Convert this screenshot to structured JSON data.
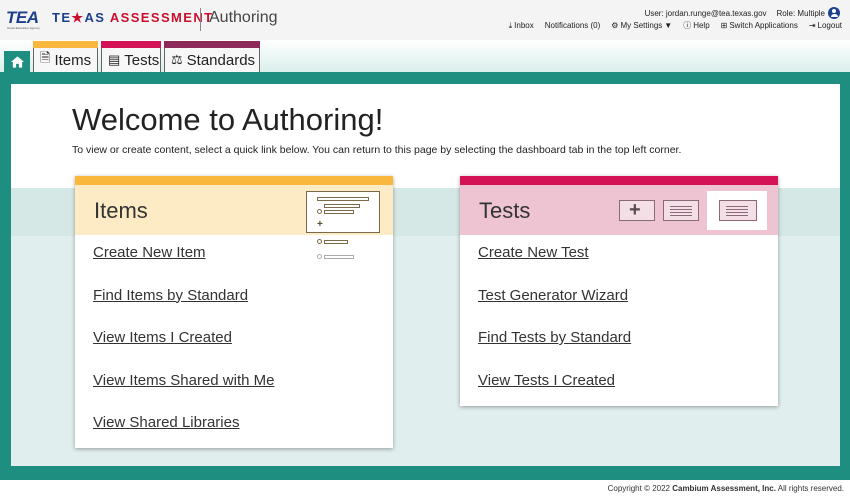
{
  "header": {
    "logo_tea": "TEA",
    "logo_tea_sub": "Texas Education Agency",
    "logo_texas_1": "TE",
    "logo_texas_2": "AS ",
    "logo_texas_3": "ASSESSMENT",
    "app_title": "Authoring",
    "user_label": "User: jordan.runge@tea.texas.gov",
    "role_label": "Role: Multiple",
    "nav": {
      "inbox": "Inbox",
      "notifications": "Notifications (0)",
      "settings": "My Settings",
      "help": "Help",
      "switch_apps": "Switch Applications",
      "logout": "Logout"
    }
  },
  "tabs": {
    "items": "Items",
    "tests": "Tests",
    "standards": "Standards"
  },
  "welcome": {
    "title": "Welcome to Authoring!",
    "subtitle": "To view or create content, select a quick link below. You can return to this page by selecting the dashboard tab in the top left corner."
  },
  "items_card": {
    "title": "Items",
    "links": [
      "Create New Item",
      "Find Items by Standard",
      "View Items I Created",
      "View Items Shared with Me",
      "View Shared Libraries"
    ]
  },
  "tests_card": {
    "title": "Tests",
    "links": [
      "Create New Test",
      "Test Generator Wizard",
      "Find Tests by Standard",
      "View Tests I Created"
    ]
  },
  "footer": {
    "copyright": "Copyright © 2022 ",
    "company": "Cambium Assessment, Inc.",
    "rights": " All rights reserved."
  },
  "colors": {
    "teal": "#1d8e80",
    "items_accent": "#f9b83d",
    "tests_accent": "#d41357",
    "standards_accent": "#8e2a5a",
    "brand_blue": "#1e3f8c"
  }
}
